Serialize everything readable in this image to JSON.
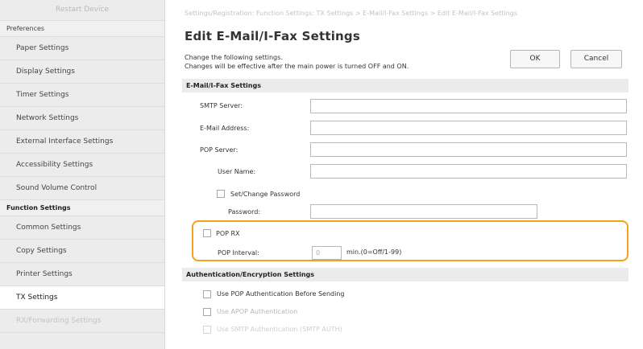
{
  "sidebar": {
    "restart_label": "Restart Device",
    "preferences_header": "Preferences",
    "preferences_items": [
      {
        "label": "Paper Settings"
      },
      {
        "label": "Display Settings"
      },
      {
        "label": "Timer Settings"
      },
      {
        "label": "Network Settings"
      },
      {
        "label": "External Interface Settings"
      },
      {
        "label": "Accessibility Settings"
      },
      {
        "label": "Sound Volume Control"
      }
    ],
    "function_header": "Function Settings",
    "function_items": [
      {
        "label": "Common Settings"
      },
      {
        "label": "Copy Settings"
      },
      {
        "label": "Printer Settings"
      },
      {
        "label": "TX Settings"
      },
      {
        "label": "RX/Forwarding Settings"
      }
    ]
  },
  "main": {
    "breadcrumb": "Settings/Registration: Function Settings: TX Settings > E-Mail/I-Fax Settings > Edit E-Mail/I-Fax Settings",
    "title": "Edit E-Mail/I-Fax Settings",
    "desc_line1": "Change the following settings.",
    "desc_line2": "Changes will be effective after the main power is turned OFF and ON.",
    "ok_label": "OK",
    "cancel_label": "Cancel",
    "section1": "E-Mail/I-Fax Settings",
    "smtp_server_label": "SMTP Server:",
    "email_address_label": "E-Mail Address:",
    "pop_server_label": "POP Server:",
    "user_name_label": "User Name:",
    "set_change_password_label": "Set/Change Password",
    "password_label": "Password:",
    "pop_rx_label": "POP RX",
    "pop_interval_label": "POP Interval:",
    "pop_interval_value": "0",
    "pop_interval_unit": "min.(0=Off/1-99)",
    "section2": "Authentication/Encryption Settings",
    "auth_items": [
      {
        "label": "Use POP Authentication Before Sending"
      },
      {
        "label": "Use APOP Authentication"
      },
      {
        "label": "Use SMTP Authentication (SMTP AUTH)"
      }
    ]
  },
  "colors": {
    "highlight": "#f3a21b",
    "sidebar_bg": "#ececec",
    "section_bg": "#ebebeb"
  }
}
